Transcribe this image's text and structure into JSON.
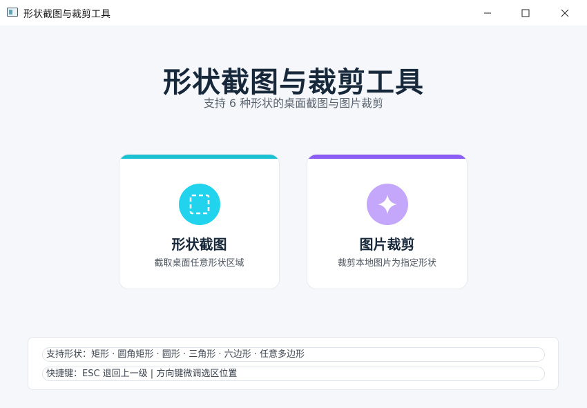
{
  "window": {
    "title": "形状截图与裁剪工具",
    "buttons": [
      "minimize",
      "maximize",
      "close"
    ]
  },
  "header": {
    "title": "形状截图与裁剪工具",
    "subtitle": "支持 6 种形状的桌面截图与图片裁剪"
  },
  "cards": [
    {
      "title": "形状截图",
      "description": "截取桌面任意形状区域",
      "icon": "dashed-square-icon",
      "accent": "#1cc2d2",
      "icon_bg": "#22d3ee"
    },
    {
      "title": "图片裁剪",
      "description": "裁剪本地图片为指定形状",
      "icon": "sparkle-icon",
      "accent": "#8b5cf6",
      "icon_bg": "#c4a6fb"
    }
  ],
  "info": {
    "shapes": "支持形状：矩形 · 圆角矩形 · 圆形 · 三角形 · 六边形 · 任意多边形",
    "shortcuts": "快捷键：ESC 退回上一级 | 方向键微调选区位置"
  }
}
